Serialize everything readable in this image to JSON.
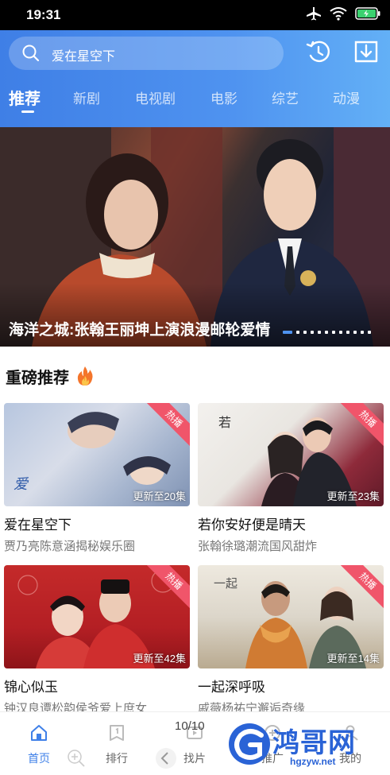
{
  "status": {
    "time": "19:31"
  },
  "search": {
    "placeholder": "爱在星空下"
  },
  "tabs": [
    {
      "label": "推荐",
      "active": true
    },
    {
      "label": "新剧"
    },
    {
      "label": "电视剧"
    },
    {
      "label": "电影"
    },
    {
      "label": "综艺"
    },
    {
      "label": "动漫"
    }
  ],
  "banner": {
    "title": "海洋之城:张翰王丽坤上演浪漫邮轮爱情",
    "page_count": 12,
    "current_page": 1
  },
  "section": {
    "title": "重磅推荐"
  },
  "cards": [
    {
      "title": "爱在星空下",
      "subtitle": "贾乃亮陈意涵揭秘娱乐圈",
      "update": "更新至20集",
      "badge": "热播"
    },
    {
      "title": "若你安好便是晴天",
      "subtitle": "张翰徐璐潮流国风甜炸",
      "update": "更新至23集",
      "badge": "热播"
    },
    {
      "title": "锦心似玉",
      "subtitle": "钟汉良谭松韵侯爷爱上庶女",
      "update": "更新至42集",
      "badge": "热播"
    },
    {
      "title": "一起深呼吸",
      "subtitle": "戚薇杨祐宁邂逅奇缘",
      "update": "更新至14集",
      "badge": "热播"
    }
  ],
  "bottom_nav": [
    {
      "label": "首页",
      "icon": "home-icon",
      "active": true
    },
    {
      "label": "排行",
      "icon": "ranking-icon"
    },
    {
      "label": "找片",
      "icon": "find-icon"
    },
    {
      "label": "推广",
      "icon": "promote-icon"
    },
    {
      "label": "我的",
      "icon": "profile-icon"
    }
  ],
  "overlay": {
    "page_indicator": "10/10"
  },
  "watermark": {
    "text": "鸿哥网",
    "url": "hgzyw.net"
  },
  "colors": {
    "accent": "#3f80e8",
    "header_start": "#3f7fe6",
    "header_end": "#63b0f6",
    "badge": "#f0556a"
  }
}
